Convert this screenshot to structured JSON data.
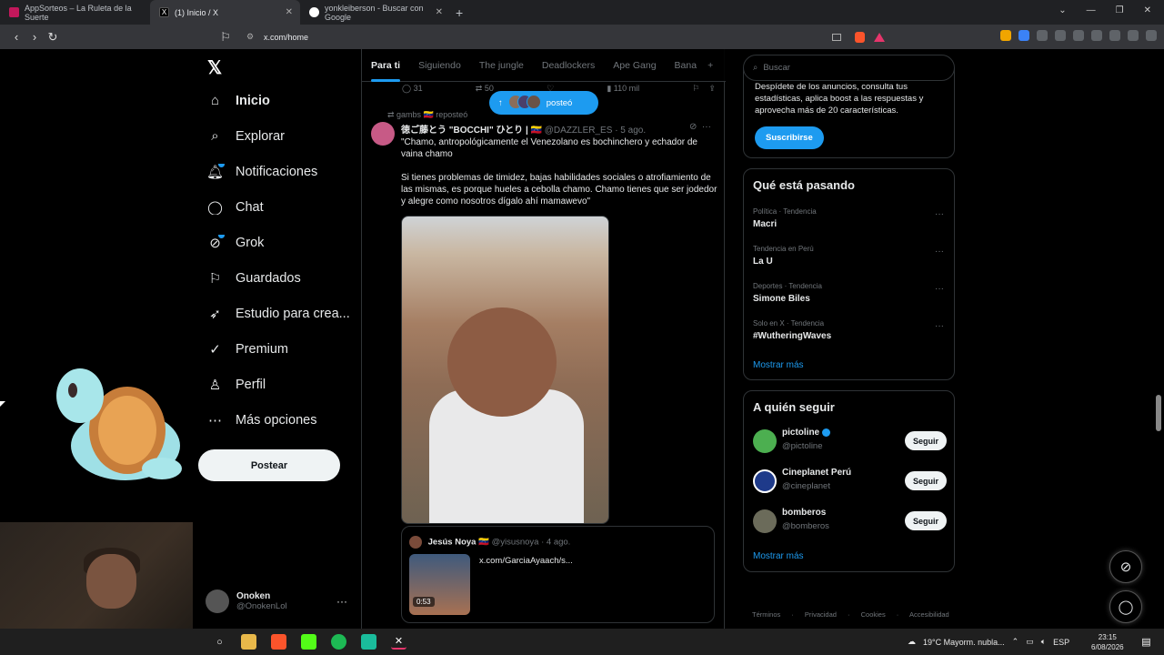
{
  "browser": {
    "tabs": [
      {
        "title": "AppSorteos – La Ruleta de la Suerte",
        "color": "#c2185b"
      },
      {
        "title": "(1) Inicio / X",
        "color": "#000000"
      },
      {
        "title": "yonkleiberson - Buscar con Google",
        "color": "#4285f4"
      }
    ],
    "new_tab": "+",
    "url": "x.com/home"
  },
  "nav": {
    "items": [
      {
        "label": "Inicio",
        "icon": "home-icon"
      },
      {
        "label": "Explorar",
        "icon": "search-icon"
      },
      {
        "label": "Notificaciones",
        "icon": "bell-icon"
      },
      {
        "label": "Chat",
        "icon": "chat-icon"
      },
      {
        "label": "Grok",
        "icon": "grok-icon"
      },
      {
        "label": "Guardados",
        "icon": "bookmark-icon"
      },
      {
        "label": "Estudio para crea...",
        "icon": "rocket-icon"
      },
      {
        "label": "Premium",
        "icon": "premium-icon"
      },
      {
        "label": "Perfil",
        "icon": "profile-icon"
      },
      {
        "label": "Más opciones",
        "icon": "more-icon"
      }
    ],
    "post_button": "Postear",
    "user_name": "Onoken",
    "user_handle": "@OnokenLol"
  },
  "feed": {
    "tabs": [
      "Para ti",
      "Siguiendo",
      "The jungle",
      "Deadlockers",
      "Ape Gang",
      "Bana"
    ],
    "add_tab": "+",
    "prev_actions": {
      "replies": "31",
      "reposts": "50",
      "views": "110 mil"
    },
    "new_posts_pill": "posteó",
    "repost_label": "gambs 🇻🇪 reposteó",
    "tweet": {
      "author": "徳ご藤とう \"BOCCHI\" ひとり | 🇻🇪",
      "handle": "@DAZZLER_ES",
      "date": "· 5 ago.",
      "text1": "\"Chamo, antropológicamente el Venezolano es bochinchero y echador de vaina chamo",
      "text2": "Si tienes problemas de timidez, bajas habilidades sociales o atrofiamiento de las mismas, es porque hueles a cebolla chamo. Chamo tienes que ser jodedor y alegre como nosotros dígalo ahí mamawevo\""
    },
    "quote": {
      "author": "Jesús Noya 🇻🇪",
      "handle": "@yisusnoya",
      "date": "· 4 ago.",
      "link": "x.com/GarciaAyaach/s...",
      "duration": "0:53"
    }
  },
  "right": {
    "search_placeholder": "Buscar",
    "premium_text": "Despídete de los anuncios, consulta tus estadísticas, aplica boost a las respuestas y aprovecha más de 20 características.",
    "subscribe": "Suscribirse",
    "trends_title": "Qué está pasando",
    "trends": [
      {
        "context": "Política · Tendencia",
        "topic": "Macri"
      },
      {
        "context": "Tendencia en Perú",
        "topic": "La U"
      },
      {
        "context": "Deportes · Tendencia",
        "topic": "Simone Biles"
      },
      {
        "context": "Solo en X · Tendencia",
        "topic": "#WutheringWaves"
      }
    ],
    "show_more": "Mostrar más",
    "follow_title": "A quién seguir",
    "follow": [
      {
        "name": "pictoline",
        "handle": "@pictoline",
        "color": "#4caf50"
      },
      {
        "name": "Cineplanet Perú",
        "handle": "@cineplanet",
        "color": "#1e3a8a"
      },
      {
        "name": "bomberos",
        "handle": "@bomberos",
        "color": "#6b6b5a"
      }
    ],
    "follow_button": "Seguir",
    "footer": "Términos · Privacidad · Cookies · Accesibilidad"
  },
  "taskbar": {
    "weather": "19°C  Mayorm. nubla...",
    "lang": "ESP",
    "time": "23:15",
    "date": "6/08/2026"
  },
  "colors": {
    "accent": "#1d9bf0",
    "background": "#000000"
  }
}
